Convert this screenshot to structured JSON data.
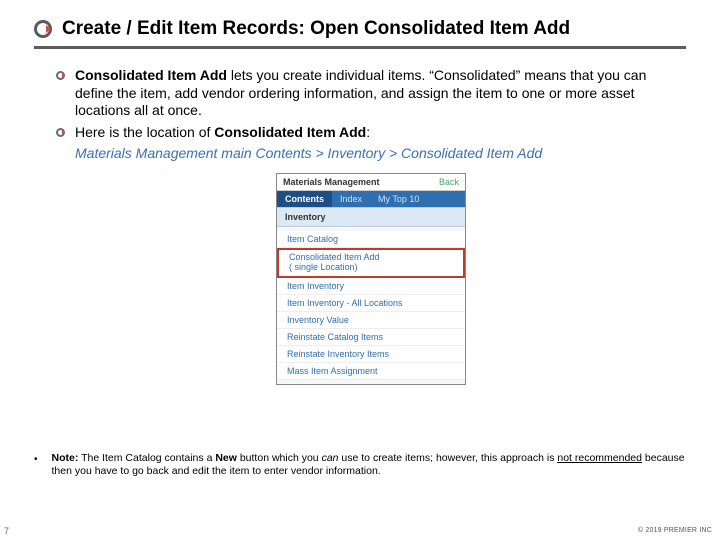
{
  "title": "Create / Edit Item Records: Open Consolidated Item Add",
  "bullets": {
    "b1_lead": "Consolidated Item Add",
    "b1_rest": " lets you create individual items. “Consolidated” means that  you can define the item, add vendor ordering information, and assign the item to one or more asset locations all at once.",
    "b2_lead": "Here is the location of ",
    "b2_bold": "Consolidated Item Add",
    "b2_tail": ":",
    "path": "Materials Management main Contents > Inventory > Consolidated Item Add"
  },
  "screenshot": {
    "header": "Materials Management",
    "back": "Back",
    "tabs": {
      "contents": "Contents",
      "index": "Index",
      "mytop10": "My Top 10"
    },
    "section": "Inventory",
    "items": {
      "catalog": "Item Catalog",
      "consolidated_line1": "Consolidated Item Add",
      "consolidated_line2": "( single Location)",
      "inv": "Item Inventory",
      "inv_all": "Item Inventory - All Locations",
      "inv_value": "Inventory Value",
      "reinstate_cat": "Reinstate Catalog Items",
      "reinstate_inv": "Reinstate Inventory Items",
      "mass": "Mass Item Assignment"
    }
  },
  "note": {
    "bullet": "•",
    "lead": "Note:",
    "t1": " The Item Catalog contains a ",
    "new": "New",
    "t2": " button which you ",
    "can": "can",
    "t3": " use  to create items; however, this approach is ",
    "notrec": "not recommended",
    "t4": " because then you have to go back and edit the item to enter vendor information."
  },
  "pagenum": "7",
  "copyright": "© 2019 PREMIER INC"
}
